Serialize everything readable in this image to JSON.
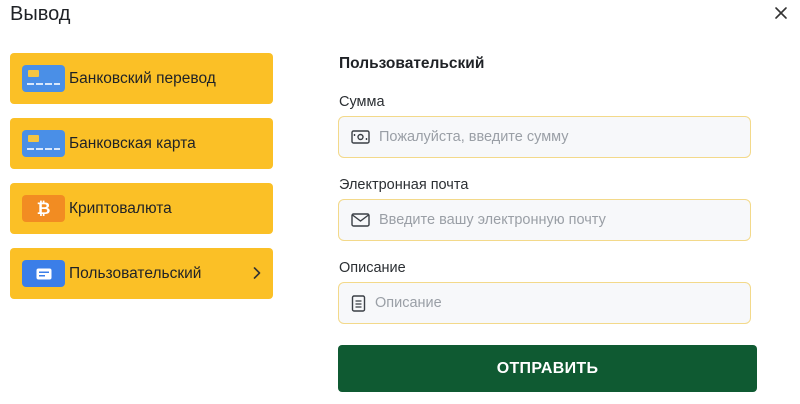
{
  "header": {
    "title": "Вывод",
    "close_icon": "close-icon"
  },
  "methods": [
    {
      "label": "Банковский перевод",
      "icon": "bank-card-icon"
    },
    {
      "label": "Банковская карта",
      "icon": "bank-card-icon"
    },
    {
      "label": "Криптовалюта",
      "icon": "bitcoin-icon"
    },
    {
      "label": "Пользовательский",
      "icon": "message-icon",
      "selected": true
    }
  ],
  "form": {
    "section_title": "Пользовательский",
    "amount": {
      "label": "Сумма",
      "placeholder": "Пожалуйста, введите сумму",
      "value": ""
    },
    "email": {
      "label": "Электронная почта",
      "placeholder": "Введите вашу электронную почту",
      "value": ""
    },
    "description": {
      "label": "Описание",
      "placeholder": "Описание",
      "value": ""
    },
    "submit_label": "ОТПРАВИТЬ"
  },
  "colors": {
    "accent": "#fbc026",
    "submit": "#0f5a32",
    "field_border": "#f3d98a"
  }
}
